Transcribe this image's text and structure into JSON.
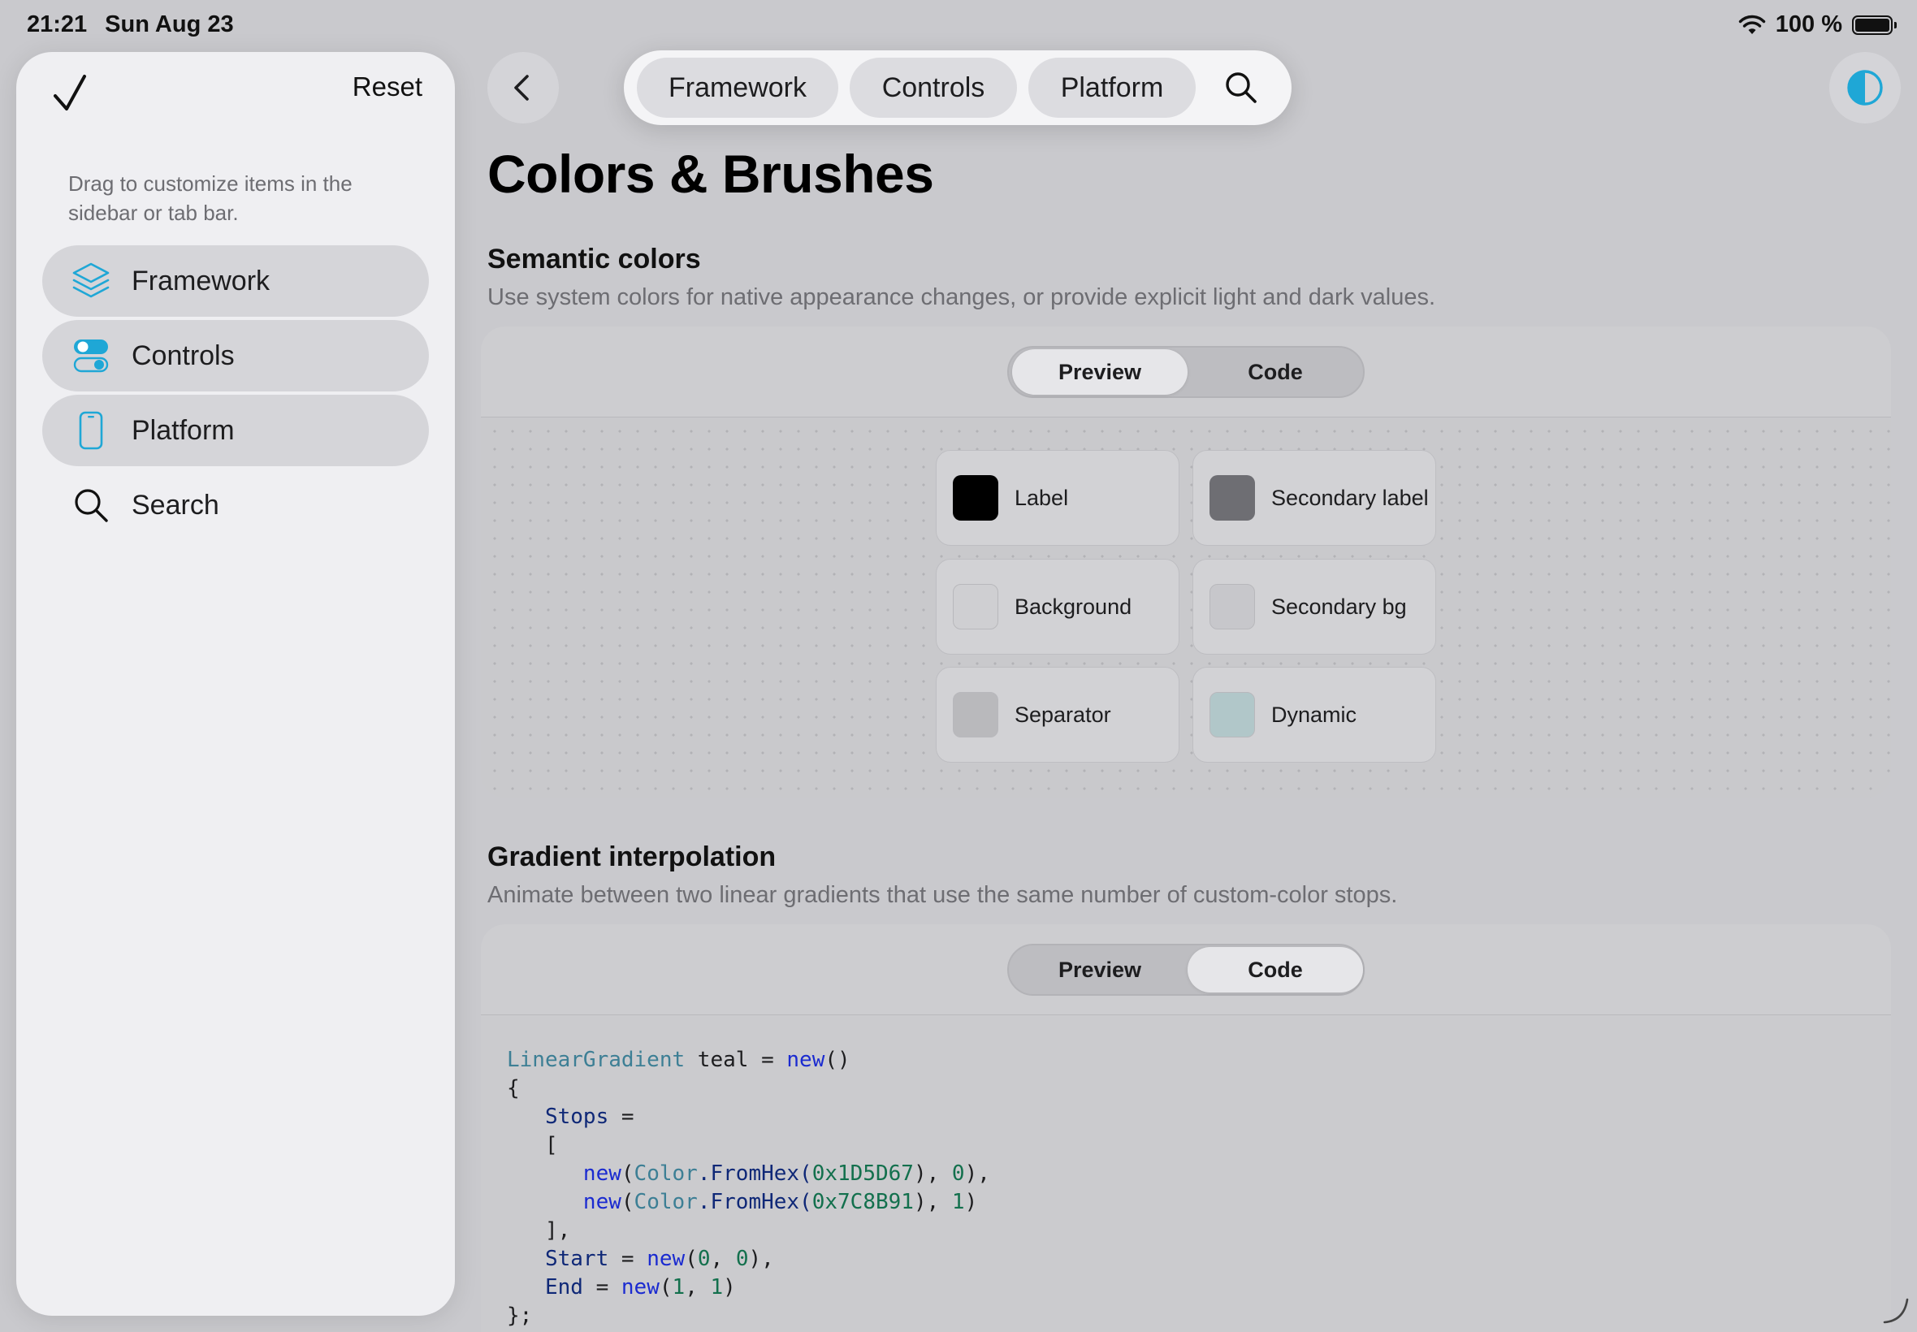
{
  "status_bar": {
    "time": "21:21",
    "date": "Sun Aug 23",
    "battery_text": "100 %",
    "battery_level": 1.0
  },
  "sidebar": {
    "done_icon": "checkmark-icon",
    "reset_label": "Reset",
    "hint": "Drag to customize items in the sidebar or tab bar.",
    "items": [
      {
        "label": "Framework",
        "icon": "layers-icon"
      },
      {
        "label": "Controls",
        "icon": "toggles-icon"
      },
      {
        "label": "Platform",
        "icon": "phone-icon"
      },
      {
        "label": "Search",
        "icon": "search-icon"
      }
    ]
  },
  "toolbar": {
    "back_icon": "chevron-left-icon",
    "tabs": [
      "Framework",
      "Controls",
      "Platform"
    ],
    "search_icon": "search-icon",
    "theme_icon": "contrast-icon"
  },
  "page": {
    "title": "Colors & Brushes"
  },
  "semantic": {
    "title": "Semantic colors",
    "description": "Use system colors for native appearance changes, or provide explicit light and dark values.",
    "segment": {
      "options": [
        "Preview",
        "Code"
      ],
      "selected": "Preview"
    },
    "swatches": [
      {
        "name": "Label",
        "color": "#000000"
      },
      {
        "name": "Secondary label",
        "color": "#6e6e73"
      },
      {
        "name": "Background",
        "color": "#cfcfd2"
      },
      {
        "name": "Secondary bg",
        "color": "#c7c7cb"
      },
      {
        "name": "Separator",
        "color": "#b9b9bc"
      },
      {
        "name": "Dynamic",
        "color": "#b1c7c9"
      }
    ]
  },
  "gradient": {
    "title": "Gradient interpolation",
    "description": "Animate between two linear gradients that use the same number of custom-color stops.",
    "segment": {
      "options": [
        "Preview",
        "Code"
      ],
      "selected": "Code"
    },
    "code": {
      "l1_type": "LinearGradient",
      "l1_rest": " teal = ",
      "l1_new": "new",
      "l1_paren": "()",
      "l2": "{",
      "l3_prop": "Stops",
      "l3_rest": " =",
      "l4": "[",
      "l5_new": "new",
      "l5_type": "Color",
      "l5_method": ".FromHex(",
      "l5_hex": "0x1D5D67",
      "l5_sep": "), ",
      "l5_num": "0",
      "l5_end": "),",
      "l6_new": "new",
      "l6_type": "Color",
      "l6_method": ".FromHex(",
      "l6_hex": "0x7C8B91",
      "l6_sep": "), ",
      "l6_num": "1",
      "l6_end": ")",
      "l7": "],",
      "l8_prop": "Start",
      "l8_eq": " = ",
      "l8_new": "new",
      "l8_open": "(",
      "l8_a": "0",
      "l8_comma": ", ",
      "l8_b": "0",
      "l8_end": "),",
      "l9_prop": "End",
      "l9_eq": " = ",
      "l9_new": "new",
      "l9_open": "(",
      "l9_a": "1",
      "l9_comma": ", ",
      "l9_b": "1",
      "l9_end": ")",
      "l10": "};"
    }
  },
  "colors": {
    "accent": "#1fa7d6"
  }
}
